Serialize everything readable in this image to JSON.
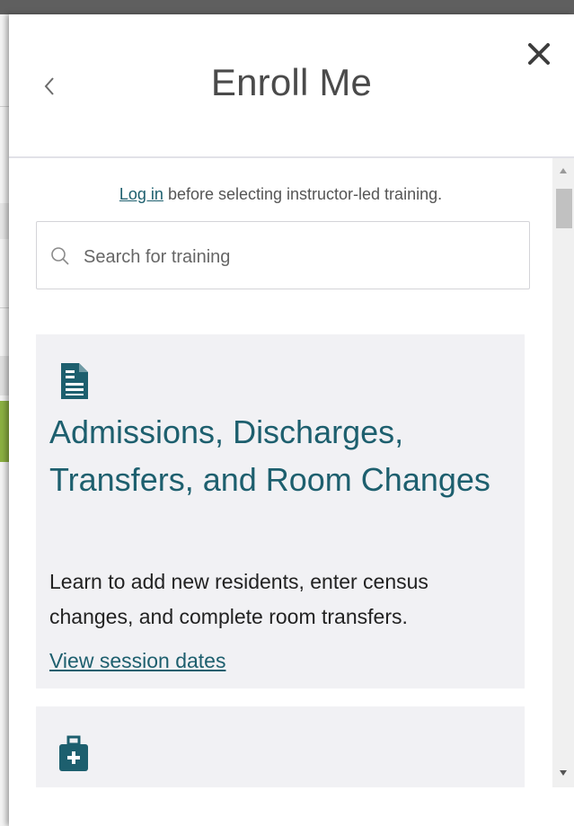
{
  "panel": {
    "title": "Enroll Me",
    "back_label": "‹",
    "close_label": "✕"
  },
  "login_prompt": {
    "link_text": "Log in",
    "text": " before selecting instructor-led training."
  },
  "search": {
    "placeholder": "Search for training",
    "value": ""
  },
  "cards": [
    {
      "icon": "document-icon",
      "title": "Admissions, Discharges, Transfers, and Room Changes",
      "description": "Learn to add new residents, enter census changes, and complete room transfers.",
      "link": "View session dates"
    },
    {
      "icon": "medical-kit-icon"
    }
  ],
  "colors": {
    "accent": "#1d5f6e",
    "card_background": "#f1f1f4",
    "title_text": "#4a4a4a"
  }
}
